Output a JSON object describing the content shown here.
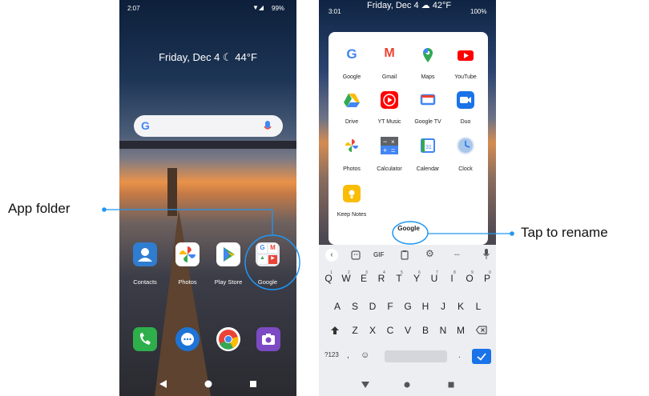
{
  "annotations": {
    "app_folder": "App folder",
    "tap_to_rename": "Tap to rename"
  },
  "home": {
    "time": "2:07",
    "battery": "99%",
    "date_weather": "Friday, Dec 4 ☾ 44°F",
    "dock_apps": [
      "Contacts",
      "Photos",
      "Play Store",
      "Google"
    ]
  },
  "folder_screen": {
    "time": "3:01",
    "date_weather": "Friday, Dec 4 ☁ 42°F",
    "battery": "100%",
    "folder_name": "Google",
    "apps": [
      "Google",
      "Gmail",
      "Maps",
      "YouTube",
      "Drive",
      "YT Music",
      "Google TV",
      "Duo",
      "Photos",
      "Calculator",
      "Calendar",
      "Clock",
      "Keep Notes"
    ]
  },
  "keyboard": {
    "toolbar": [
      "GIF",
      "..."
    ],
    "row1": [
      "Q",
      "W",
      "E",
      "R",
      "T",
      "Y",
      "U",
      "I",
      "O",
      "P"
    ],
    "row1_sup": [
      "1",
      "2",
      "3",
      "4",
      "5",
      "6",
      "7",
      "8",
      "9",
      "0"
    ],
    "row2": [
      "A",
      "S",
      "D",
      "F",
      "G",
      "H",
      "J",
      "K",
      "L"
    ],
    "row3": [
      "Z",
      "X",
      "C",
      "V",
      "B",
      "N",
      "M"
    ],
    "mode_key": "?123",
    "comma": ",",
    "period": "."
  },
  "icons": {
    "search": "g-logo",
    "mic": "mic-icon",
    "back": "back-icon",
    "home": "home-icon",
    "recents": "recents-icon"
  },
  "colors": {
    "accent": "#1a73e8",
    "annotation_line": "#2196f3"
  }
}
